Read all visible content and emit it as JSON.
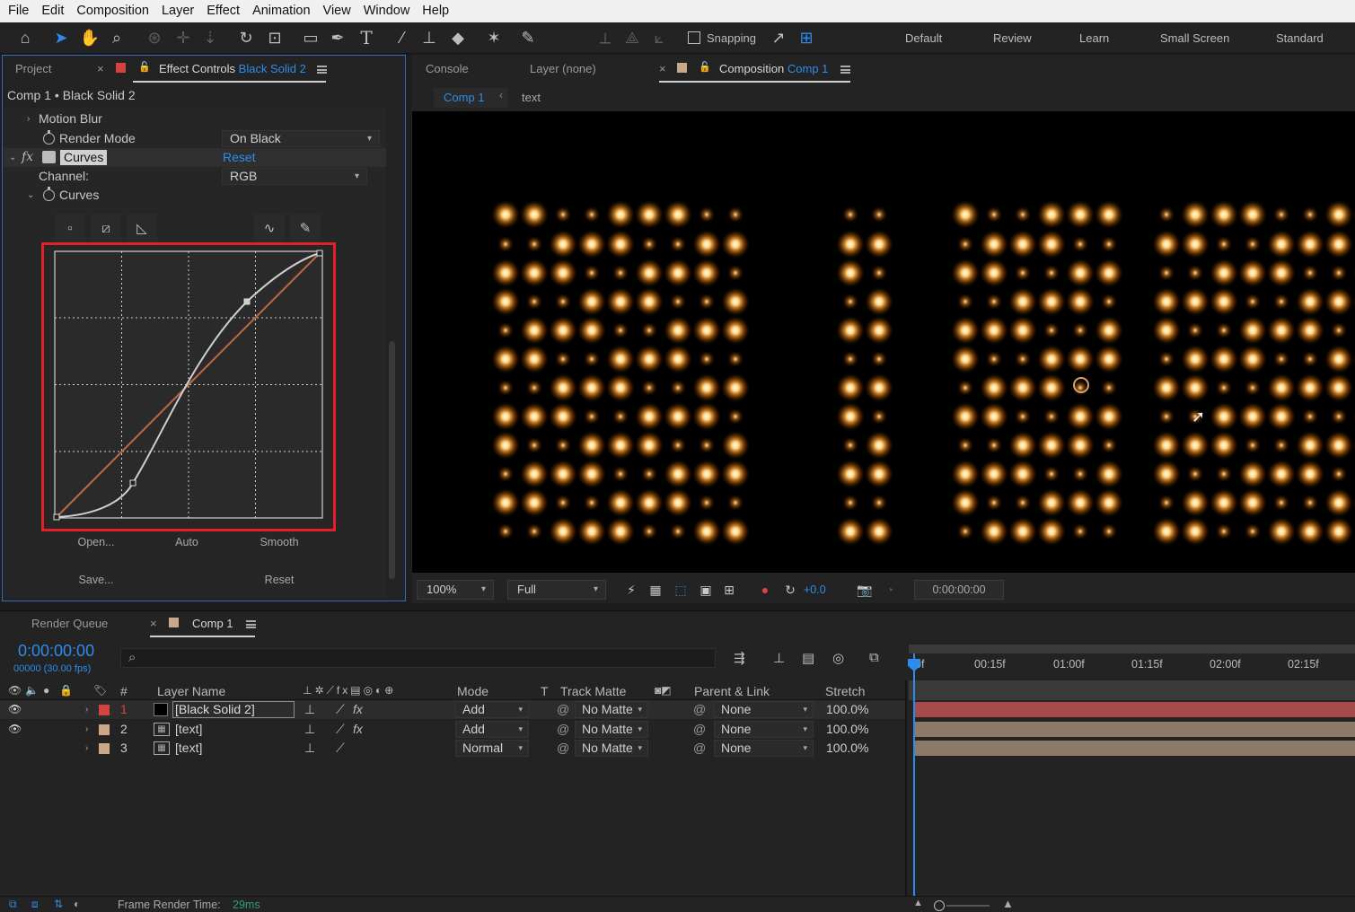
{
  "menu": [
    "File",
    "Edit",
    "Composition",
    "Layer",
    "Effect",
    "Animation",
    "View",
    "Window",
    "Help"
  ],
  "toolbar": {
    "snapping_label": "Snapping",
    "workspaces": [
      "Default",
      "Review",
      "Learn",
      "Small Screen",
      "Standard"
    ]
  },
  "left_panel": {
    "tab_project": "Project",
    "tab_effect_controls": "Effect Controls",
    "tab_effect_controls_layer": "Black Solid 2",
    "breadcrumb": "Comp 1 • Black Solid 2",
    "motion_blur_label": "Motion Blur",
    "render_mode_label": "Render Mode",
    "render_mode_value": "On Black",
    "fx_label": "fx",
    "effect_name": "Curves",
    "reset_link": "Reset",
    "channel_label": "Channel:",
    "channel_value": "RGB",
    "curves_label": "Curves",
    "buttons": {
      "open": "Open...",
      "auto": "Auto",
      "smooth": "Smooth",
      "save": "Save...",
      "reset": "Reset"
    }
  },
  "viewer_tabs": {
    "console": "Console",
    "layer": "Layer (none)",
    "composition": "Composition",
    "composition_name": "Comp 1",
    "crumb_comp": "Comp 1",
    "crumb_text": "text"
  },
  "viewer_bar": {
    "zoom": "100%",
    "resolution": "Full",
    "exposure": "+0.0",
    "timecode": "0:00:00:00"
  },
  "timeline": {
    "tab_render_queue": "Render Queue",
    "tab_comp": "Comp 1",
    "current_time": "0:00:00:00",
    "frame_info": "00000 (30.00 fps)",
    "search_icon_glyph": "⌕",
    "columns": {
      "number": "#",
      "layer_name": "Layer Name",
      "mode": "Mode",
      "t": "T",
      "track_matte": "Track Matte",
      "parent": "Parent & Link",
      "stretch": "Stretch"
    },
    "ruler": [
      "0f",
      "00:15f",
      "01:00f",
      "01:15f",
      "02:00f",
      "02:15f"
    ],
    "layers": [
      {
        "index": "1",
        "name": "[Black Solid 2]",
        "mode": "Add",
        "track_matte": "No Matte",
        "parent": "None",
        "stretch": "100.0%",
        "label_color": "#d4433f",
        "bar_color": "#a44a4a"
      },
      {
        "index": "2",
        "name": "[text]",
        "mode": "Add",
        "track_matte": "No Matte",
        "parent": "None",
        "stretch": "100.0%",
        "label_color": "#c9a88a",
        "bar_color": "#8c7a66"
      },
      {
        "index": "3",
        "name": "[text]",
        "mode": "Normal",
        "track_matte": "No Matte",
        "parent": "None",
        "stretch": "100.0%",
        "label_color": "#c9a88a",
        "bar_color": "#8c7a66"
      }
    ]
  },
  "status": {
    "frame_render_label": "Frame Render Time:",
    "frame_render_value": "29ms"
  },
  "colors": {
    "accent": "#2d8ceb",
    "highlight_box": "#e3202a",
    "curve_line": "#b96a45"
  }
}
